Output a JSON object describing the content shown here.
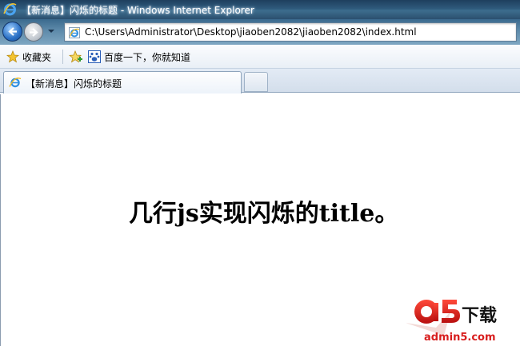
{
  "window": {
    "title": "【新消息】闪烁的标题 - Windows Internet Explorer"
  },
  "navigation": {
    "address_url": "C:\\Users\\Administrator\\Desktop\\jiaoben2082\\jiaoben2082\\index.html"
  },
  "favorites_bar": {
    "favorites_label": "收藏夹",
    "items": [
      {
        "label": "百度一下，你就知道",
        "icon": "baidu-paw-icon"
      }
    ]
  },
  "tabs": [
    {
      "label": "【新消息】闪烁的标题",
      "active": true
    }
  ],
  "page": {
    "headline": "几行js实现闪烁的title。"
  },
  "watermark": {
    "logo_letters": "a5",
    "logo_suffix": "下载",
    "site": "admin5.com"
  },
  "colors": {
    "titlebar": "#2f5a7c",
    "watermark_red": "#d81e1e"
  }
}
